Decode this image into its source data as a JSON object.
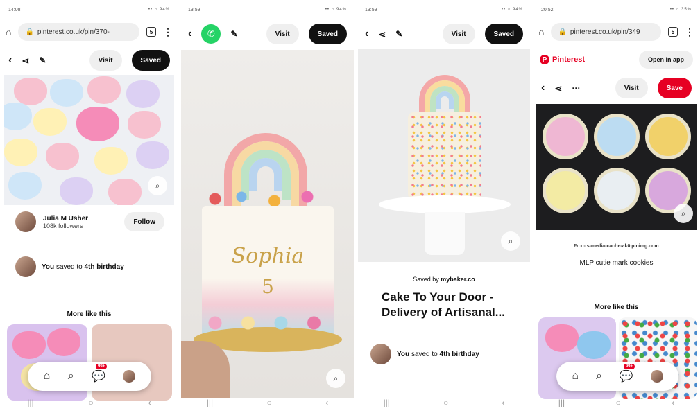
{
  "phone1": {
    "status_time": "14:08",
    "status_icons": "•• ○ 94%",
    "url": "pinterest.co.uk/pin/370-",
    "tab_count": "5",
    "visit": "Visit",
    "saved": "Saved",
    "user_name": "Julia M Usher",
    "user_followers": "108k followers",
    "follow": "Follow",
    "saved_you": "You",
    "saved_to": "saved to",
    "board": "4th birthday",
    "more_like_this": "More like this",
    "notif_badge": "99+"
  },
  "phone2": {
    "status_time": "13:59",
    "status_icons": "•• ○ 94%",
    "visit": "Visit",
    "saved": "Saved",
    "cake_name": "Sophia",
    "cake_number": "5"
  },
  "phone3": {
    "status_time": "13:59",
    "status_icons": "•• ○ 94%",
    "visit": "Visit",
    "saved": "Saved",
    "saved_by_label": "Saved by",
    "saved_by_user": "mybaker.co",
    "title": "Cake To Your Door - Delivery of Artisanal...",
    "saved_you": "You",
    "saved_to": "saved to",
    "board": "4th birthday"
  },
  "phone4": {
    "status_time": "20:52",
    "status_icons": "•• ○ 35%",
    "url": "pinterest.co.uk/pin/349",
    "tab_count": "5",
    "brand": "Pinterest",
    "open_in_app": "Open in app",
    "visit": "Visit",
    "save": "Save",
    "from_label": "From",
    "from_source": "s-media-cache-ak0.pinimg.com",
    "description": "MLP cutie mark cookies",
    "more_like_this": "More like this",
    "notif_badge": "99+"
  },
  "colors": {
    "pinterest_red": "#e60023",
    "saved_black": "#111111",
    "whatsapp_green": "#25d366"
  }
}
